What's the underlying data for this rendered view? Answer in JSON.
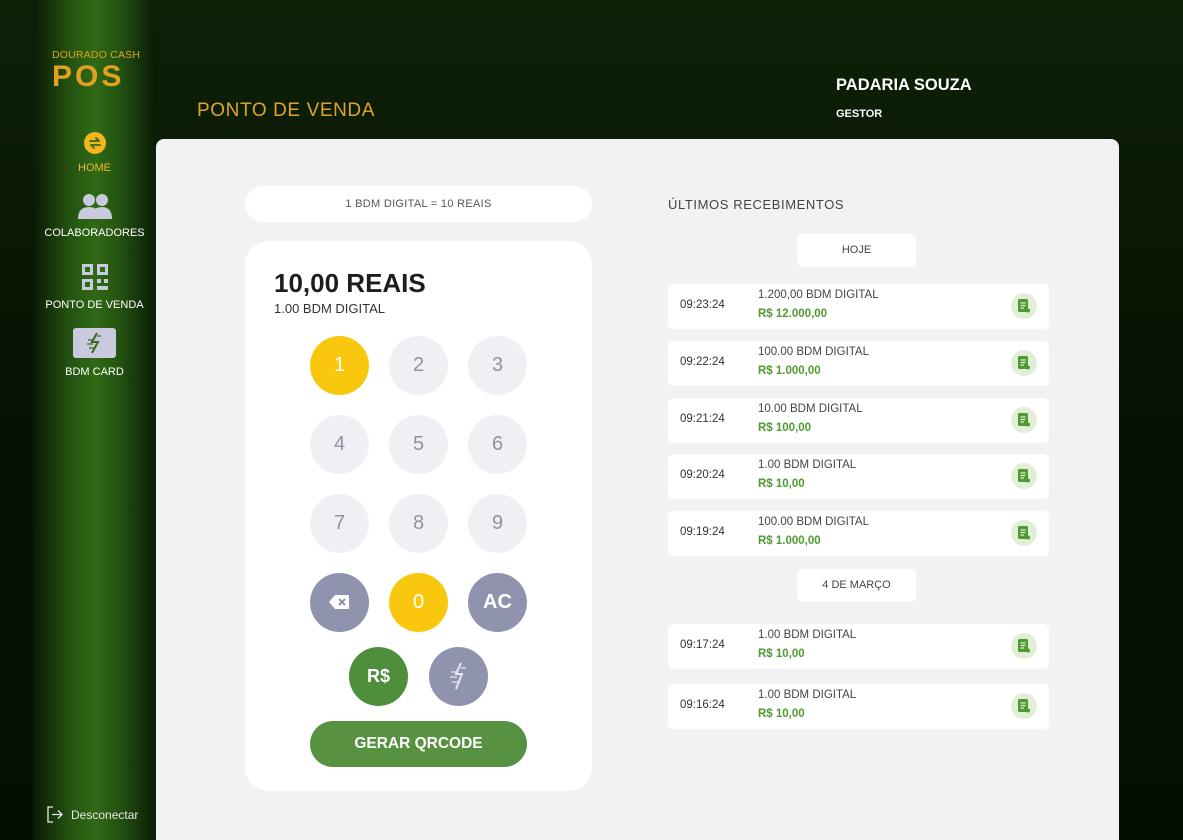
{
  "brand": {
    "tagline": "DOURADO CASH",
    "name": "POS"
  },
  "nav": {
    "home": "HOME",
    "colaboradores": "COLABORADORES",
    "pdv": "PONTO DE VENDA",
    "card": "BDM CARD"
  },
  "logout": "Desconectar",
  "header": {
    "title": "PONTO DE VENDA",
    "store": "PADARIA SOUZA",
    "role": "GESTOR"
  },
  "pos": {
    "rate": "1 BDM DIGITAL = 10 REAIS",
    "amount": "10,00 REAIS",
    "amount_bdm": "1.00 BDM DIGITAL",
    "keys": [
      "1",
      "2",
      "3",
      "4",
      "5",
      "6",
      "7",
      "8",
      "9"
    ],
    "zero": "0",
    "clear": "AC",
    "currency": "R$",
    "generate": "GERAR QRCODE"
  },
  "receipts": {
    "title": "ÚLTIMOS RECEBIMENTOS",
    "groups": [
      {
        "label": "HOJE",
        "items": [
          {
            "time": "09:23:24",
            "bdm": "1.200,00 BDM DIGITAL",
            "reais": "R$ 12.000,00"
          },
          {
            "time": "09:22:24",
            "bdm": "100.00 BDM DIGITAL",
            "reais": "R$ 1.000,00"
          },
          {
            "time": "09:21:24",
            "bdm": "10.00 BDM DIGITAL",
            "reais": "R$ 100,00"
          },
          {
            "time": "09:20:24",
            "bdm": "1.00 BDM DIGITAL",
            "reais": "R$ 10,00"
          },
          {
            "time": "09:19:24",
            "bdm": "100.00 BDM DIGITAL",
            "reais": "R$ 1.000,00"
          }
        ]
      },
      {
        "label": "4 DE MARÇO",
        "items": [
          {
            "time": "09:17:24",
            "bdm": "1.00 BDM DIGITAL",
            "reais": "R$ 10,00"
          },
          {
            "time": "09:16:24",
            "bdm": "1.00 BDM DIGITAL",
            "reais": "R$ 10,00"
          }
        ]
      }
    ]
  },
  "colors": {
    "gold": "#e2a21f",
    "green": "#56923f",
    "yellow": "#f9c80e",
    "gray": "#8f93ad"
  },
  "icons": [
    "exchange-icon",
    "users-icon",
    "qrcode-icon",
    "bdm-card-icon",
    "logout-icon",
    "backspace-icon",
    "bdm-icon",
    "receipt-icon"
  ]
}
